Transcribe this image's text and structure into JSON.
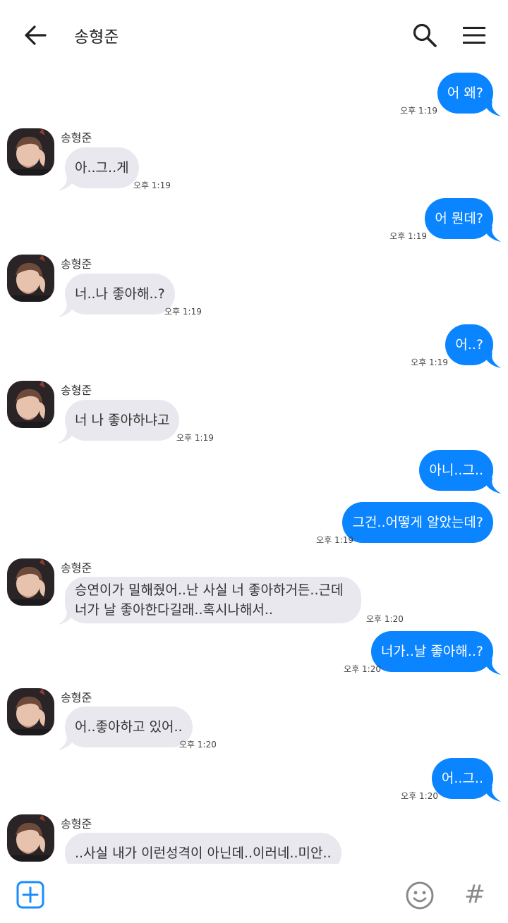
{
  "header": {
    "title": "송형준",
    "back_icon": "arrow-left-icon",
    "search_icon": "search-icon",
    "menu_icon": "hamburger-menu-icon"
  },
  "colors": {
    "sent_bubble": "#0a84ff",
    "received_bubble": "#e8e8ee"
  },
  "messages": [
    {
      "dir": "sent",
      "text": "어 왜?",
      "time": "오후 1:19"
    },
    {
      "dir": "recv",
      "sender": "송형준",
      "text": "아..그..게",
      "time": "오후 1:19"
    },
    {
      "dir": "sent",
      "text": "어 뭔데?",
      "time": "오후 1:19"
    },
    {
      "dir": "recv",
      "sender": "송형준",
      "text": "너..나 좋아해..?",
      "time": "오후 1:19"
    },
    {
      "dir": "sent",
      "text": "어..?",
      "time": "오후 1:19"
    },
    {
      "dir": "recv",
      "sender": "송형준",
      "text": "너 나 좋아하냐고",
      "time": "오후 1:19"
    },
    {
      "dir": "sent",
      "text": "아니..그..",
      "time": ""
    },
    {
      "dir": "sent",
      "text": "그건..어떻게 알았는데?",
      "time": "오후 1:19"
    },
    {
      "dir": "recv",
      "sender": "송형준",
      "text": "승연이가 밀해줬어..난 사실 너 좋아하거든..근데 너가 날 좋아한다길래..혹시나해서..",
      "time": "오후 1:20"
    },
    {
      "dir": "sent",
      "text": "너가..날 좋아해..?",
      "time": "오후 1:20"
    },
    {
      "dir": "recv",
      "sender": "송형준",
      "text": "어..좋아하고 있어..",
      "time": "오후 1:20"
    },
    {
      "dir": "sent",
      "text": "어..그..",
      "time": "오후 1:20"
    },
    {
      "dir": "recv",
      "sender": "송형준",
      "text": "..사실 내가 이런성격이 아닌데..이러네..미안..",
      "time": ""
    }
  ],
  "bottom": {
    "plus_icon": "plus-square-icon",
    "emoji_icon": "smiley-icon",
    "hash_label": "#"
  }
}
